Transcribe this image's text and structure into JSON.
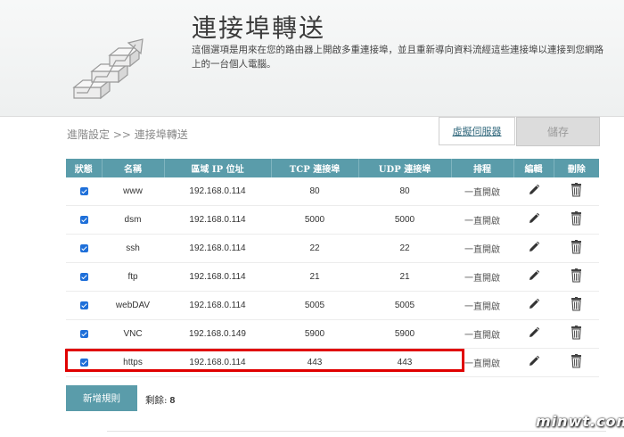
{
  "header": {
    "title": "連接埠轉送",
    "description": "這個選項是用來在您的路由器上開啟多重連接埠，並且重新導向資料流經這些連接埠以連接到您網路上的一台個人電腦。",
    "logo_icon": "stairs-arrow-icon"
  },
  "subbar": {
    "breadcrumb": "進階設定 >> 連接埠轉送",
    "virtual_server_label": "虛擬伺服器",
    "save_label": "儲存"
  },
  "table": {
    "headers": [
      "狀態",
      "名稱",
      "區域 IP 位址",
      "TCP 連接埠",
      "UDP 連接埠",
      "排程",
      "編輯",
      "刪除"
    ],
    "rows": [
      {
        "enabled": true,
        "name": "www",
        "ip": "192.168.0.114",
        "tcp": "80",
        "udp": "80",
        "schedule": "一直開啟"
      },
      {
        "enabled": true,
        "name": "dsm",
        "ip": "192.168.0.114",
        "tcp": "5000",
        "udp": "5000",
        "schedule": "一直開啟"
      },
      {
        "enabled": true,
        "name": "ssh",
        "ip": "192.168.0.114",
        "tcp": "22",
        "udp": "22",
        "schedule": "一直開啟"
      },
      {
        "enabled": true,
        "name": "ftp",
        "ip": "192.168.0.114",
        "tcp": "21",
        "udp": "21",
        "schedule": "一直開啟"
      },
      {
        "enabled": true,
        "name": "webDAV",
        "ip": "192.168.0.114",
        "tcp": "5005",
        "udp": "5005",
        "schedule": "一直開啟"
      },
      {
        "enabled": true,
        "name": "VNC",
        "ip": "192.168.0.149",
        "tcp": "5900",
        "udp": "5900",
        "schedule": "一直開啟"
      },
      {
        "enabled": true,
        "name": "https",
        "ip": "192.168.0.114",
        "tcp": "443",
        "udp": "443",
        "schedule": "一直開啟"
      }
    ]
  },
  "footer": {
    "add_rule_label": "新增規則",
    "remaining_label": "剩餘:",
    "remaining_count": "8"
  },
  "watermark": "minwt.com",
  "colors": {
    "accent": "#5a9caa",
    "highlight": "#e00000",
    "checkbox": "#1e6fd9"
  }
}
